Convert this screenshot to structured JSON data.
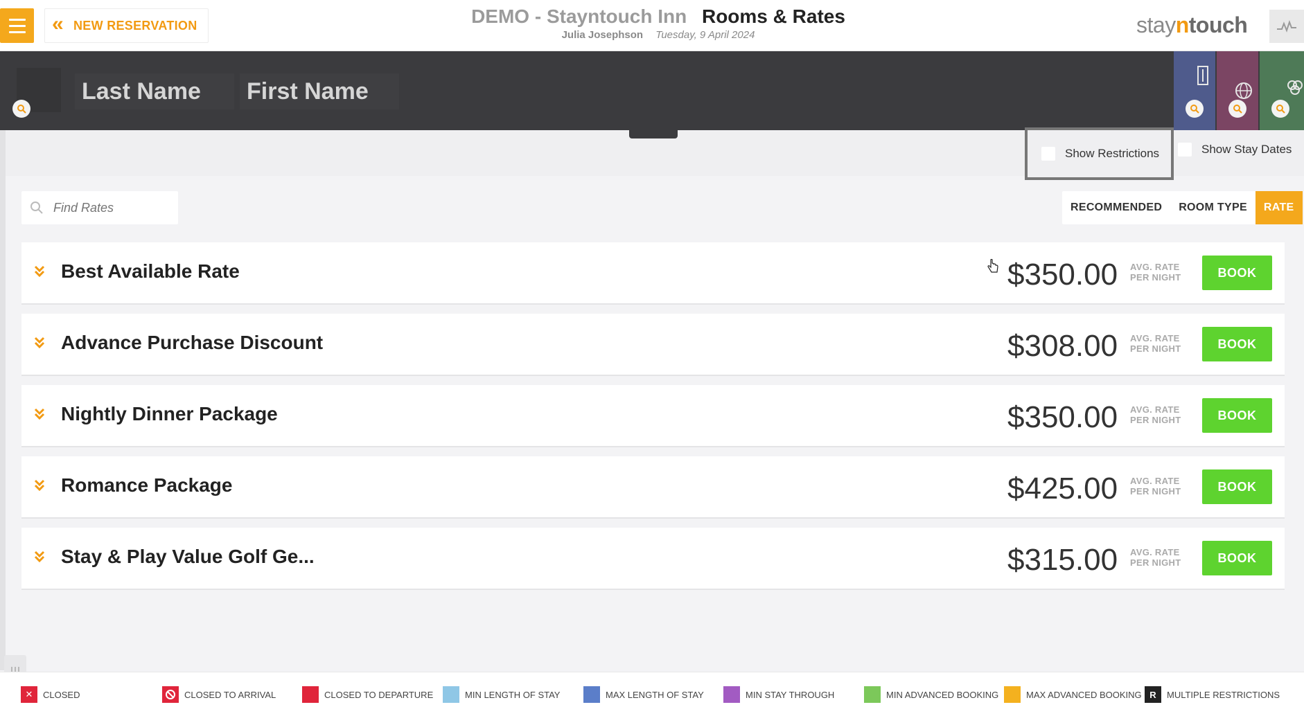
{
  "header": {
    "back_label": "NEW RESERVATION",
    "hotel_name": "DEMO - Stayntouch Inn",
    "page_title": "Rooms & Rates",
    "user_name": "Julia Josephson",
    "date": "Tuesday, 9 April 2024",
    "brand": {
      "stay": "stay",
      "n": "n",
      "touch": "touch"
    },
    "icons": {
      "menu": "hamburger-icon",
      "back": "double-chevron-left-icon",
      "activity": "activity-pulse-icon"
    }
  },
  "guest_search": {
    "last_name_placeholder": "Last Name",
    "first_name_placeholder": "First Name",
    "tabs": [
      {
        "icon": "building-icon",
        "color": "#4f5b8c"
      },
      {
        "icon": "globe-icon",
        "color": "#7b4563"
      },
      {
        "icon": "group-icon",
        "color": "#4e7a57"
      }
    ]
  },
  "options": {
    "show_restrictions": "Show Restrictions",
    "show_stay_dates": "Show Stay Dates",
    "show_restrictions_checked": false,
    "show_stay_dates_checked": false
  },
  "find_rates": {
    "placeholder": "Find Rates"
  },
  "view_toggle": {
    "recommended": "RECOMMENDED",
    "room_type": "ROOM TYPE",
    "rate": "RATE",
    "active": "rate"
  },
  "rates": [
    {
      "name": "Best Available Rate",
      "price": "$350.00",
      "avg1": "AVG. RATE",
      "avg2": "PER NIGHT",
      "book": "BOOK"
    },
    {
      "name": "Advance Purchase Discount",
      "price": "$308.00",
      "avg1": "AVG. RATE",
      "avg2": "PER NIGHT",
      "book": "BOOK"
    },
    {
      "name": "Nightly Dinner Package",
      "price": "$350.00",
      "avg1": "AVG. RATE",
      "avg2": "PER NIGHT",
      "book": "BOOK"
    },
    {
      "name": "Romance Package",
      "price": "$425.00",
      "avg1": "AVG. RATE",
      "avg2": "PER NIGHT",
      "book": "BOOK"
    },
    {
      "name": "Stay & Play Value Golf Ge...",
      "price": "$315.00",
      "avg1": "AVG. RATE",
      "avg2": "PER NIGHT",
      "book": "BOOK"
    }
  ],
  "legend": [
    {
      "label": "CLOSED",
      "color": "#e0253b",
      "icon": "x-icon"
    },
    {
      "label": "CLOSED TO ARRIVAL",
      "color": "#e0253b",
      "icon": "no-entry-icon"
    },
    {
      "label": "CLOSED TO DEPARTURE",
      "color": "#e0253b",
      "icon": ""
    },
    {
      "label": "MIN LENGTH OF STAY",
      "color": "#8fc7e6",
      "icon": ""
    },
    {
      "label": "MAX LENGTH OF STAY",
      "color": "#5b7ec9",
      "icon": ""
    },
    {
      "label": "MIN STAY THROUGH",
      "color": "#a25bc2",
      "icon": ""
    },
    {
      "label": "MIN ADVANCED BOOKING",
      "color": "#7cc85a",
      "icon": ""
    },
    {
      "label": "MAX ADVANCED BOOKING",
      "color": "#f4b11f",
      "icon": ""
    },
    {
      "label": "MULTIPLE RESTRICTIONS",
      "color": "#222222",
      "icon": "R"
    }
  ]
}
